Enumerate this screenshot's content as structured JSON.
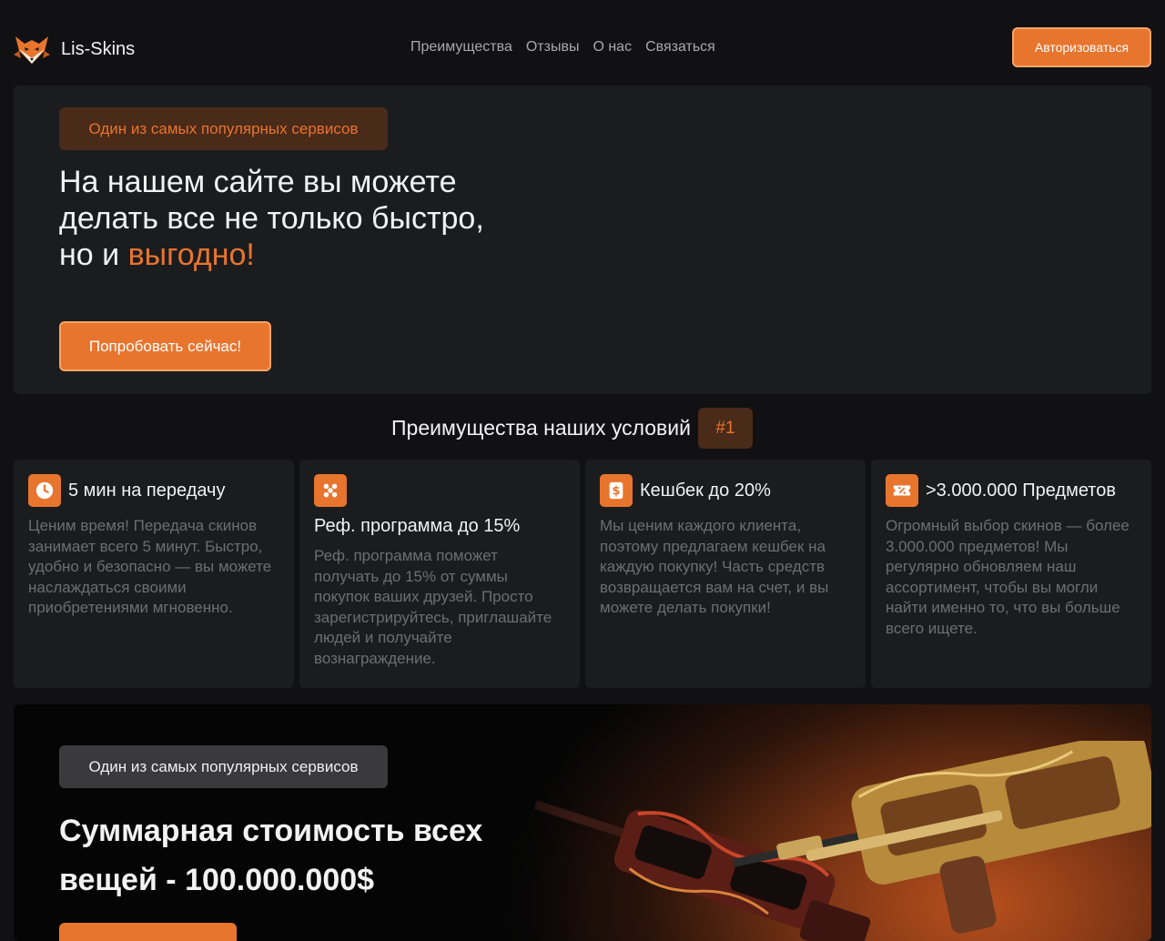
{
  "brand": {
    "name": "Lis-Skins"
  },
  "nav": {
    "items": [
      {
        "label": "Преимущества"
      },
      {
        "label": "Отзывы"
      },
      {
        "label": "О нас"
      },
      {
        "label": "Связаться"
      }
    ]
  },
  "header": {
    "login_label": "Авторизоваться"
  },
  "hero": {
    "badge": "Один из самых популярных сервисов",
    "title_line1": "На нашем сайте вы можете",
    "title_line2": "делать все не только быстро,",
    "title_line3_prefix": "но и ",
    "title_accent": "выгодно!",
    "cta_label": "Попробовать сейчас!"
  },
  "advantages": {
    "heading": "Преимущества наших условий",
    "heading_badge": "#1",
    "cards": [
      {
        "icon": "clock-icon",
        "title": "5 мин на передачу",
        "text": "Ценим время! Передача скинов занимает всего 5 минут. Быстро, удобно и безопасно — вы можете наслаждаться своими приобретениями мгновенно."
      },
      {
        "icon": "users-icon",
        "title": "Реф. программа до 15%",
        "text": "Реф. программа поможет получать до 15% от суммы покупок ваших друзей. Просто зарегистрируйтесь, приглашайте людей и получайте вознаграждение."
      },
      {
        "icon": "dollar-icon",
        "title": "Кешбек до 20%",
        "text": "Мы ценим каждого клиента, поэтому предлагаем кешбек на каждую покупку! Часть средств возвращается вам на счет, и вы можете делать покупки!"
      },
      {
        "icon": "ticket-percent-icon",
        "title": ">3.000.000 Предметов",
        "text": "Огромный выбор скинов — более 3.000.000 предметов! Мы регулярно обновляем наш ассортимент, чтобы вы могли найти именно то, что вы больше всего ищете."
      }
    ]
  },
  "promo": {
    "badge": "Один из самых популярных сервисов",
    "title_line1": "Суммарная стоимость всех",
    "title_line2": "вещей - 100.000.000$"
  },
  "colors": {
    "accent": "#e8752e",
    "accent_border": "#f7a468",
    "background": "#111113",
    "card": "#1b1c1e",
    "muted_text": "#6d6e71"
  }
}
